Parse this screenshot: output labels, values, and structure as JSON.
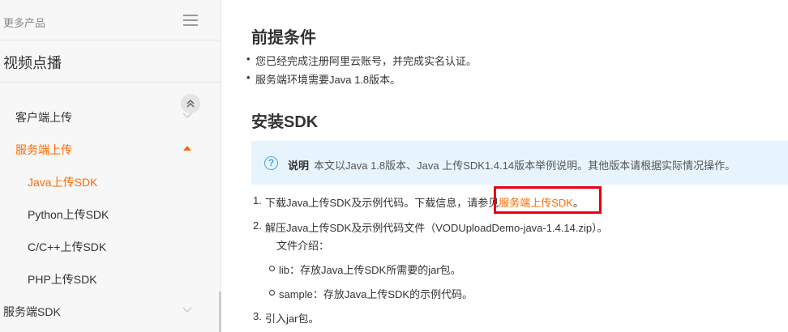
{
  "sidebar": {
    "more_products": "更多产品",
    "product_title": "视频点播",
    "items": [
      {
        "label": "客户端上传"
      },
      {
        "label": "服务端上传"
      },
      {
        "label": "Java上传SDK"
      },
      {
        "label": "Python上传SDK"
      },
      {
        "label": "C/C++上传SDK"
      },
      {
        "label": "PHP上传SDK"
      },
      {
        "label": "服务端SDK"
      }
    ]
  },
  "content": {
    "prereq_title": "前提条件",
    "prereq_bullets": [
      "您已经完成注册阿里云账号，并完成实名认证。",
      "服务端环境需要Java 1.8版本。"
    ],
    "install_title": "安装SDK",
    "note_title": "说明",
    "note_text": "本文以Java 1.8版本、Java 上传SDK1.4.14版本举例说明。其他版本请根据实际情况操作。",
    "steps": [
      {
        "num": "1.",
        "text": "下载Java上传SDK及示例代码。下载信息，请参见",
        "link": "服务端上传SDK",
        "suffix": "。"
      },
      {
        "num": "2.",
        "text": "解压Java上传SDK及示例代码文件（VODUploadDemo-java-1.4.14.zip）。"
      },
      {
        "num": "3.",
        "text": "引入jar包。"
      }
    ],
    "file_intro": "文件介绍：",
    "files": [
      "lib：存放Java上传SDK所需要的jar包。",
      "sample：存放Java上传SDK的示例代码。"
    ]
  },
  "colors": {
    "accent": "#ff6a00",
    "highlight_border": "#e60012",
    "note_bg": "#e8f4fd"
  }
}
